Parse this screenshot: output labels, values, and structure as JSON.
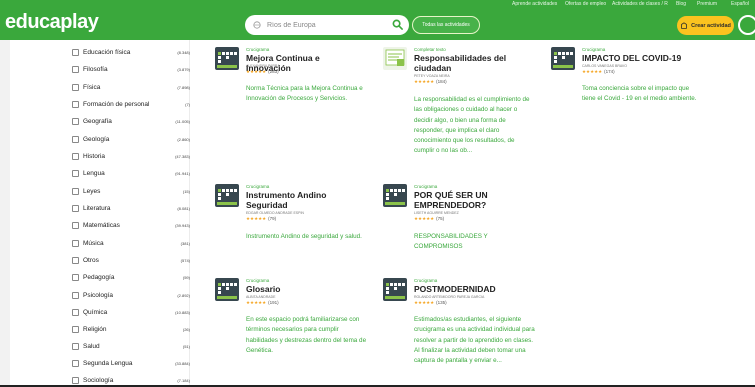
{
  "header": {
    "logo_text": "educaplay",
    "top_links": [
      "Aprende actividades",
      "Ofertas de empleo",
      "Actividades de clases / R",
      "Blog",
      "Premium",
      "Español"
    ],
    "search": {
      "value": "",
      "placeholder": "Ríos de Europa"
    },
    "filter_pill": "Todas las actividades",
    "create_button": "Crear actividad"
  },
  "sidebar": {
    "categories": [
      {
        "label": "Educación física",
        "count": "(8.348)"
      },
      {
        "label": "Filosofía",
        "count": "(3.879)"
      },
      {
        "label": "Física",
        "count": "(7.898)"
      },
      {
        "label": "Formación de personal",
        "count": "(7)"
      },
      {
        "label": "Geografía",
        "count": "(11.005)"
      },
      {
        "label": "Geología",
        "count": "(2.860)"
      },
      {
        "label": "Historia",
        "count": "(47.383)"
      },
      {
        "label": "Lengua",
        "count": "(91.941)"
      },
      {
        "label": "Leyes",
        "count": "(15)"
      },
      {
        "label": "Literatura",
        "count": "(8.081)"
      },
      {
        "label": "Matemáticas",
        "count": "(39.943)"
      },
      {
        "label": "Música",
        "count": "(381)"
      },
      {
        "label": "Otros",
        "count": "(574)"
      },
      {
        "label": "Pedagogía",
        "count": "(59)"
      },
      {
        "label": "Psicología",
        "count": "(2.892)"
      },
      {
        "label": "Química",
        "count": "(10.883)"
      },
      {
        "label": "Religión",
        "count": "(26)"
      },
      {
        "label": "Salud",
        "count": "(51)"
      },
      {
        "label": "Segunda Lengua",
        "count": "(33.884)"
      },
      {
        "label": "Sociología",
        "count": "(7.184)"
      }
    ]
  },
  "cards": [
    {
      "type": "Crucigrama",
      "title": "Mejora Continua e Innovación",
      "author": "ALEXANDRA PARRA",
      "stars": "★★★★★",
      "rating": "(283)",
      "description": "Norma Técnica para la Mejora Continua e Innovación de Procesos y Servicios."
    },
    {
      "type": "Completar texto",
      "title": "Responsabilidades del ciudadan",
      "author": "PETEY VOAZA NEIRA",
      "stars": "★★★★★",
      "rating": "(184)",
      "description": "La responsabilidad es el cumplimiento de las obligaciones o cuidado al hacer o decidir algo, o bien una forma de responder, que implica el claro conocimiento que los resultados, de cumplir o no las ob..."
    },
    {
      "type": "Crucigrama",
      "title": "IMPACTO DEL COVID-19",
      "author": "CARLOS VANEGAS BRAVO",
      "stars": "★★★★★",
      "rating": "(174)",
      "description": "Toma conciencia sobre el impacto que tiene el Covid - 19 en el medio ambiente."
    },
    {
      "type": "Crucigrama",
      "title": "Instrumento Andino Seguridad",
      "author": "EDGAR OLMEDO ANDRADE ESPIN",
      "stars": "★★★★★",
      "rating": "(79)",
      "description": "Instrumento Andino de seguridad y salud."
    },
    {
      "type": "Crucigrama",
      "title": "POR QUÉ SER UN EMPRENDEDOR?",
      "author": "LISETH AGUIRRE MENDEZ",
      "stars": "★★★★★",
      "rating": "(75)",
      "description": "RESPONSABILIDADES Y COMPROMISOS"
    },
    {
      "type": "Crucigrama",
      "title": "Glosario",
      "author": "ALBITA ANDRADE",
      "stars": "★★★★★",
      "rating": "(191)",
      "description": "En este espacio podrá familiarizarse con términos necesarios para cumplir habilidades y destrezas dentro del tema de Genética."
    },
    {
      "type": "Crucigrama",
      "title": "POSTMODERNIDAD",
      "author": "ROLANDO ARTEMIDORO PAREJA GARCIA",
      "stars": "★★★★★",
      "rating": "(135)",
      "description": "Estimados/as estudiantes, el siguiente crucigrama es una actividad individual para resolver a partir de lo aprendido en clases. Al finalizar la actividad deben tomar una captura de pantalla y enviar e..."
    }
  ]
}
